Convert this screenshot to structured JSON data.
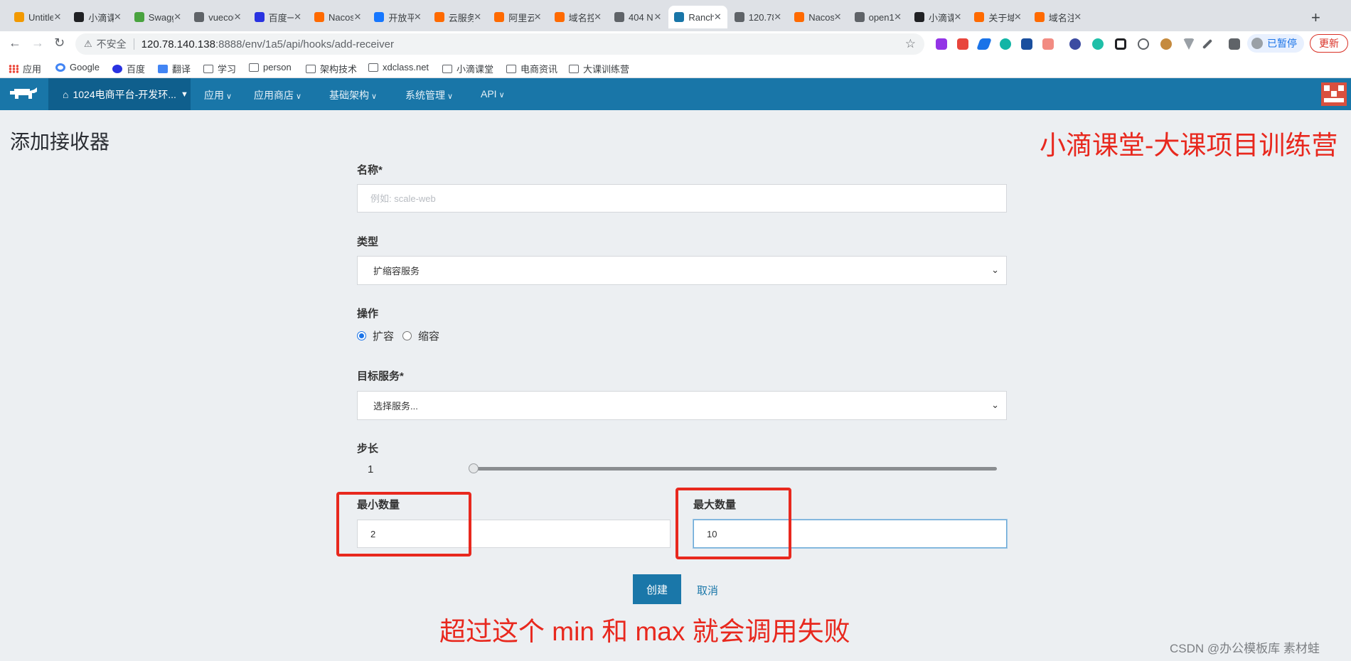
{
  "browser": {
    "tabs": [
      {
        "label": "Untitle",
        "icon": "orange-grid-icon",
        "color": "#f29900"
      },
      {
        "label": "小滴课",
        "icon": "xdclass-icon",
        "color": "#202124"
      },
      {
        "label": "Swagg",
        "icon": "swagger-icon",
        "color": "#49a33f"
      },
      {
        "label": "vuecou",
        "icon": "globe-icon",
        "color": "#5f6368"
      },
      {
        "label": "百度一",
        "icon": "baidu-paw-icon",
        "color": "#2932e1"
      },
      {
        "label": "Nacos",
        "icon": "aliyun-icon",
        "color": "#ff6a00"
      },
      {
        "label": "开放平",
        "icon": "alipay-icon",
        "color": "#1677ff"
      },
      {
        "label": "云服务",
        "icon": "aliyun-icon",
        "color": "#ff6a00"
      },
      {
        "label": "阿里云",
        "icon": "aliyun-icon",
        "color": "#ff6a00"
      },
      {
        "label": "域名控",
        "icon": "aliyun-icon",
        "color": "#ff6a00"
      },
      {
        "label": "404 N",
        "icon": "globe-icon",
        "color": "#5f6368"
      },
      {
        "label": "Ranch",
        "icon": "rancher-icon",
        "color": "#1976a8",
        "active": true
      },
      {
        "label": "120.78",
        "icon": "globe-icon",
        "color": "#5f6368"
      },
      {
        "label": "Nacos",
        "icon": "aliyun-icon",
        "color": "#ff6a00"
      },
      {
        "label": "open10",
        "icon": "globe-icon",
        "color": "#5f6368"
      },
      {
        "label": "小滴课",
        "icon": "xdclass-icon",
        "color": "#202124"
      },
      {
        "label": "关于域",
        "icon": "aliyun-icon",
        "color": "#ff6a00"
      },
      {
        "label": "域名注",
        "icon": "aliyun-icon",
        "color": "#ff6a00"
      }
    ],
    "close_glyph": "✕",
    "new_tab": "+",
    "address": {
      "insecure_label": "不安全",
      "host": "120.78.140.138",
      "path": ":8888/env/1a5/api/hooks/add-receiver"
    },
    "profile_button": "已暂停",
    "update_button": "更新",
    "bookmarks": [
      "应用",
      "Google",
      "百度",
      "翻译",
      "学习",
      "person",
      "架构技术",
      "xdclass.net",
      "小滴课堂",
      "电商资讯",
      "大课训练营"
    ]
  },
  "header": {
    "environment": "1024电商平台-开发环...",
    "nav": [
      "应用",
      "应用商店",
      "基础架构",
      "系统管理",
      "API"
    ],
    "brand_color": "#1976a8"
  },
  "form": {
    "title": "添加接收器",
    "name_label": "名称*",
    "name_placeholder": "例如: scale-web",
    "type_label": "类型",
    "type_value": "扩缩容服务",
    "action_label": "操作",
    "action_options": [
      "扩容",
      "缩容"
    ],
    "action_selected": "扩容",
    "target_label": "目标服务*",
    "target_placeholder": "选择服务...",
    "step_label": "步长",
    "step_value": "1",
    "min_label": "最小数量",
    "min_value": "2",
    "max_label": "最大数量",
    "max_value": "10",
    "create_button": "创建",
    "cancel_button": "取消"
  },
  "annotations": {
    "top_right": "小滴课堂-大课项目训练营",
    "bottom": "超过这个 min 和 max 就会调用失败",
    "color": "#e8281e"
  },
  "watermark": "CSDN @办公模板库 素材蛙"
}
